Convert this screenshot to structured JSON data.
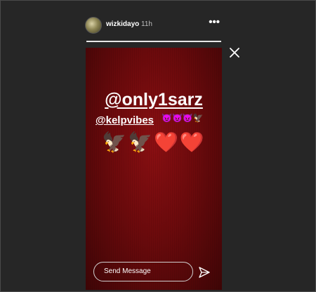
{
  "header": {
    "username": "wizkidayo",
    "time": "11h",
    "more_icon": "more-horizontal-icon"
  },
  "progress": {
    "segments": 1
  },
  "controls": {
    "close_icon": "close-x-icon"
  },
  "story": {
    "mention_primary": "@only1sarz",
    "mention_secondary": "@kelpvibes",
    "mention_secondary_emojis": "😈😈😈🦅",
    "emoji_row": "🦅🦅❤️❤️",
    "background_color": "#6b0a0c"
  },
  "composer": {
    "placeholder": "Send Message",
    "send_icon": "paper-plane-icon"
  }
}
